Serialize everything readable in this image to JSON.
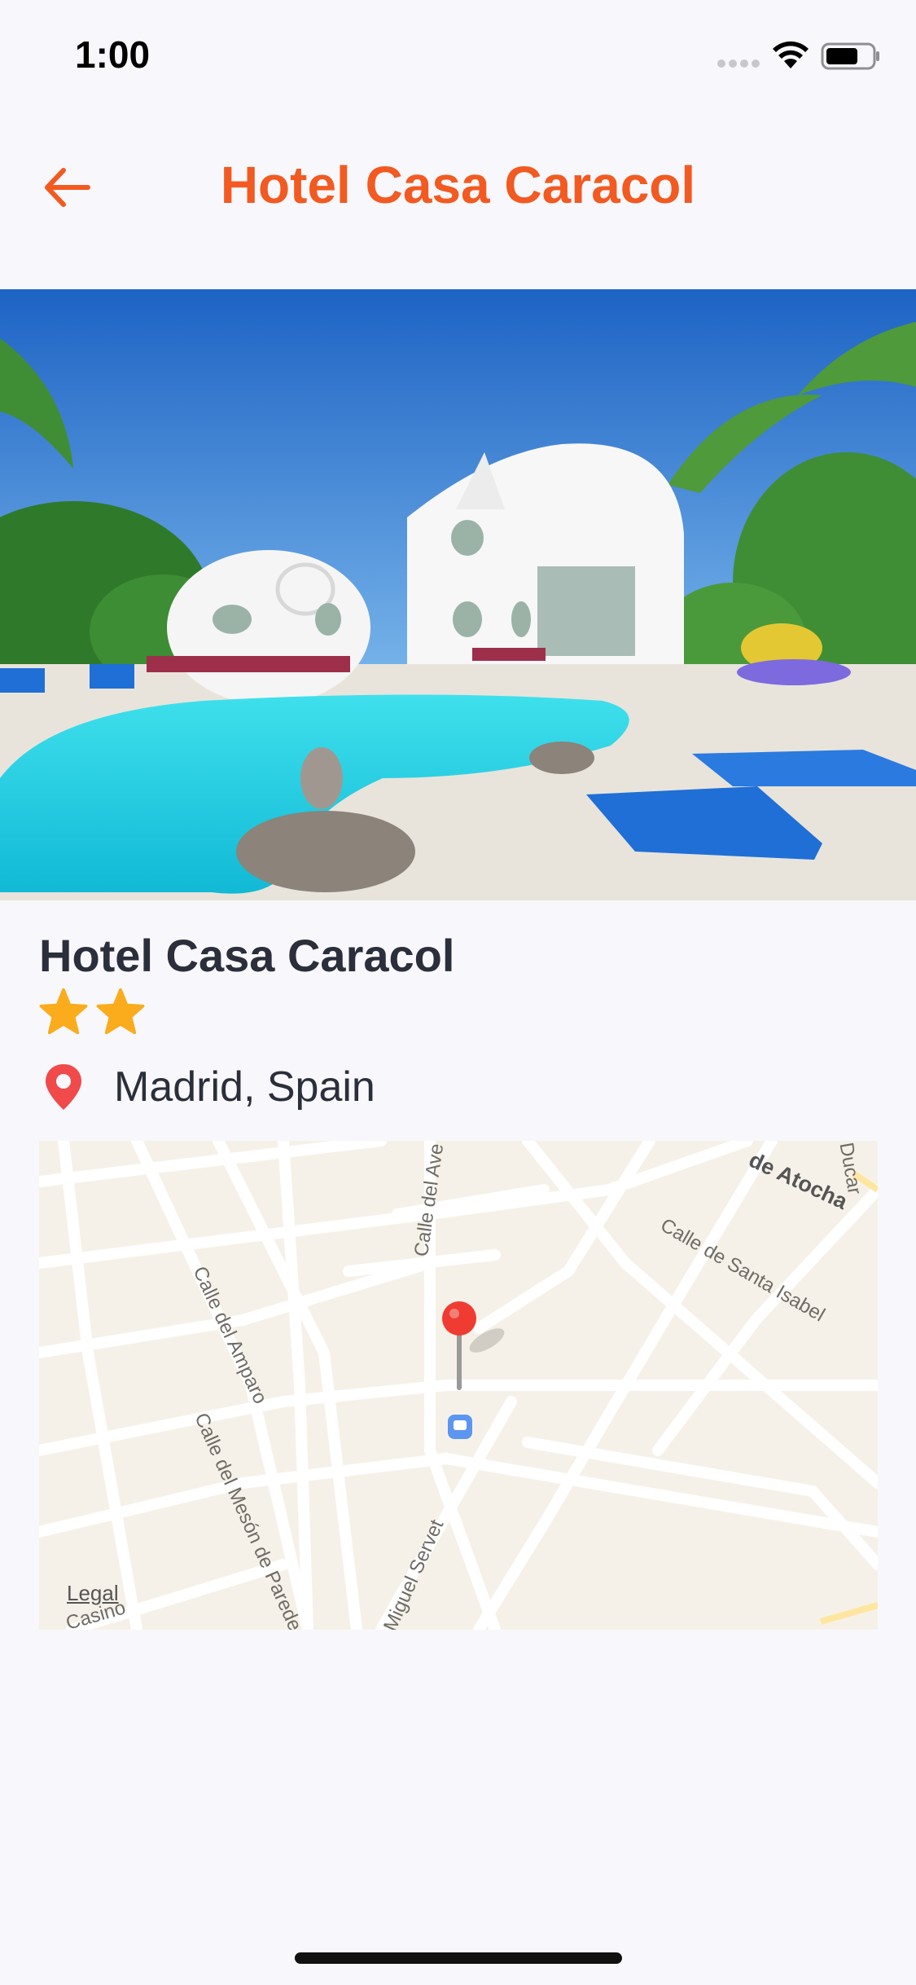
{
  "status_bar": {
    "time": "1:00"
  },
  "nav": {
    "title": "Hotel Casa Caracol",
    "back_icon": "arrow-left-icon"
  },
  "hotel": {
    "name": "Hotel Casa Caracol",
    "stars": 2,
    "location": "Madrid, Spain"
  },
  "map": {
    "legal": "Legal",
    "street_labels": [
      "Calle del Amparo",
      "Calle del Mesón de Paredes",
      "Calle del Ave",
      "Calle de Santa Isabel",
      "de Atocha",
      "Miguel Servet",
      "Casino",
      "Ducar"
    ]
  },
  "colors": {
    "accent": "#f25a21",
    "star": "#fbac1c",
    "pin": "#f04a4a",
    "text": "#2b2e3b",
    "background": "#f8f8fc"
  }
}
